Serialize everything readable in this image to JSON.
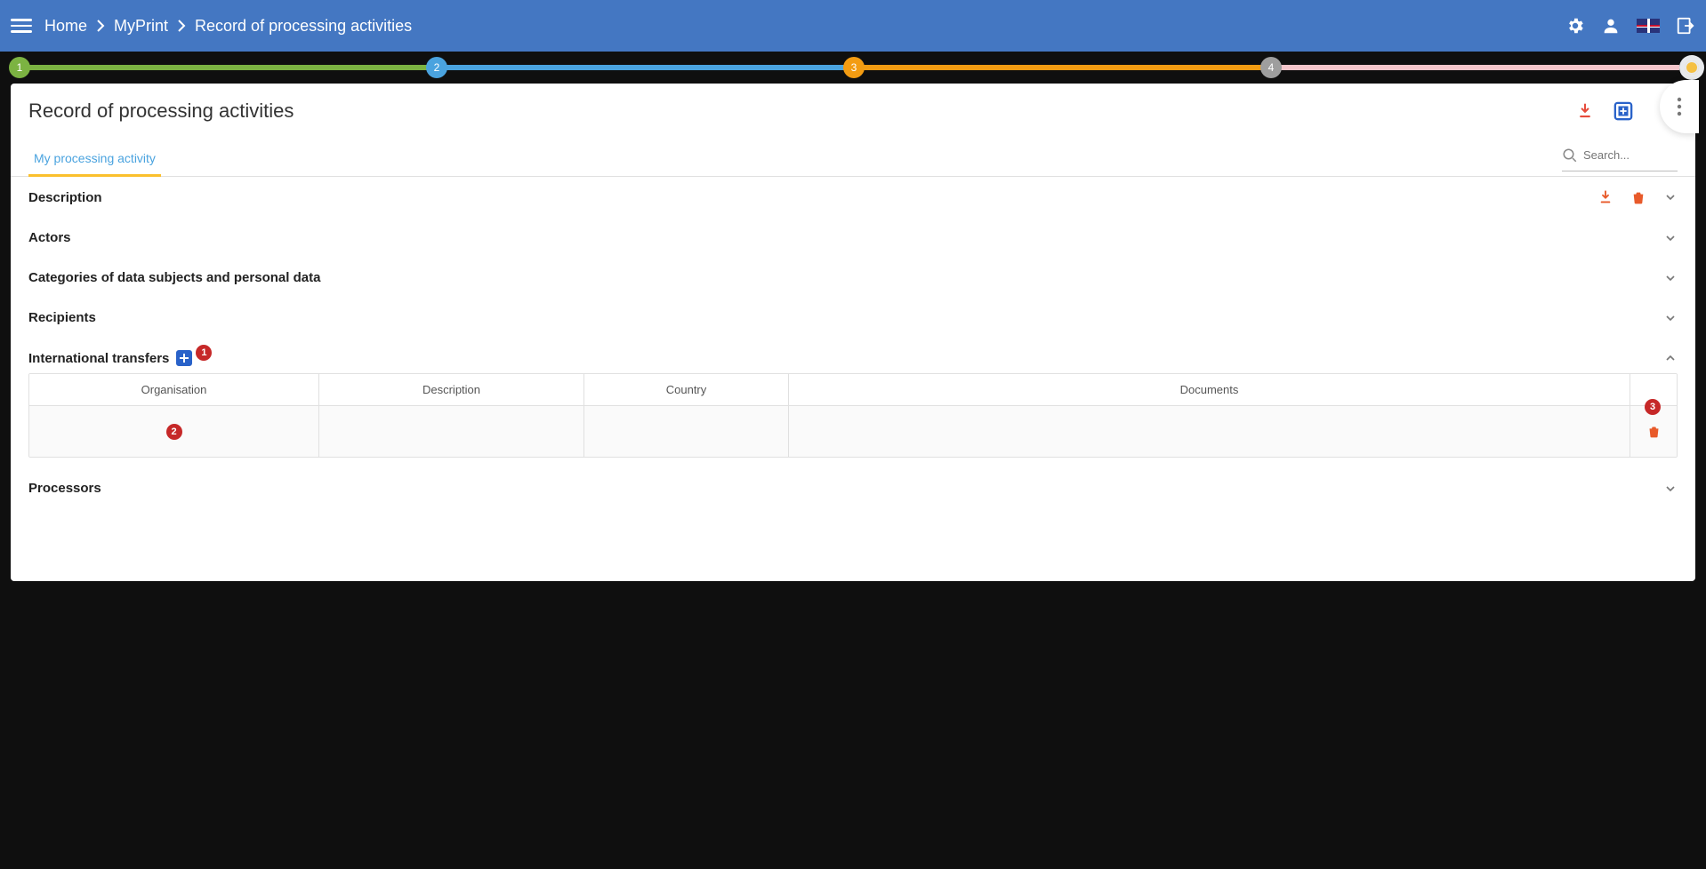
{
  "topbar": {
    "breadcrumbs": [
      "Home",
      "MyPrint",
      "Record of processing activities"
    ]
  },
  "stepper": {
    "steps": [
      "1",
      "2",
      "3",
      "4"
    ]
  },
  "card": {
    "title": "Record of processing activities"
  },
  "tabs": {
    "active": "My processing activity"
  },
  "search": {
    "placeholder": "Search..."
  },
  "sections": {
    "description": {
      "label": "Description"
    },
    "actors": {
      "label": "Actors"
    },
    "categories": {
      "label": "Categories of data subjects and personal data"
    },
    "recipients": {
      "label": "Recipients"
    },
    "transfers": {
      "label": "International transfers"
    },
    "processors": {
      "label": "Processors"
    }
  },
  "transfers_table": {
    "headers": {
      "organisation": "Organisation",
      "description": "Description",
      "country": "Country",
      "documents": "Documents"
    },
    "rows": [
      {
        "organisation": "",
        "description": "",
        "country": "",
        "documents": ""
      }
    ]
  },
  "annotations": {
    "a1": "1",
    "a2": "2",
    "a3": "3"
  }
}
